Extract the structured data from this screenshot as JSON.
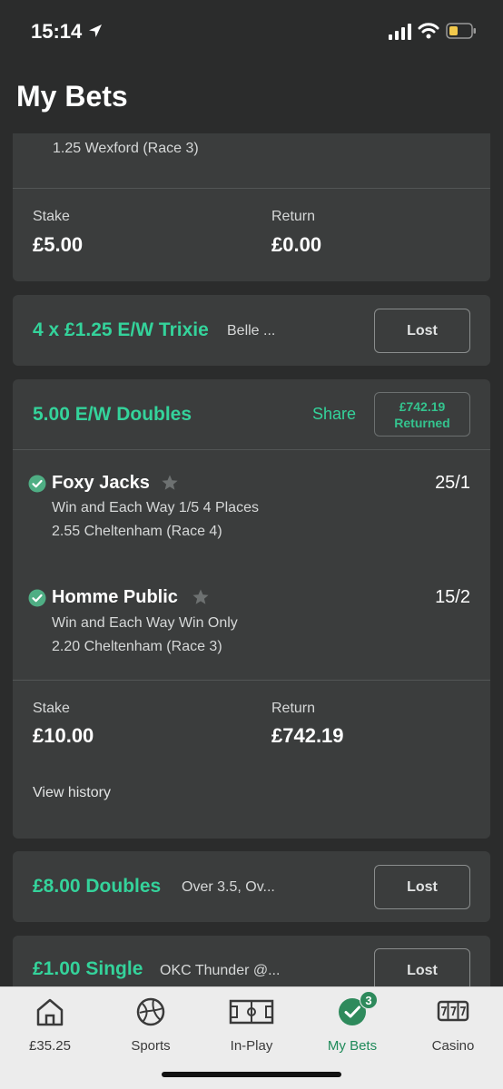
{
  "status_bar": {
    "time": "15:14"
  },
  "page": {
    "title": "My Bets"
  },
  "card1": {
    "partial_text": "1.25 Wexford (Race 3)",
    "stake_label": "Stake",
    "stake_value": "£5.00",
    "return_label": "Return",
    "return_value": "£0.00"
  },
  "card2": {
    "title": "4 x £1.25 E/W Trixie",
    "subtitle": "Belle ...",
    "status_button": "Lost"
  },
  "card3": {
    "title": "5.00 E/W Doubles",
    "share_label": "Share",
    "returned_amount": "£742.19",
    "returned_label": "Returned",
    "selections": [
      {
        "name": "Foxy Jacks",
        "odds": "25/1",
        "market": "Win and Each Way 1/5 4 Places",
        "event": "2.55 Cheltenham (Race 4)"
      },
      {
        "name": "Homme Public",
        "odds": "15/2",
        "market": "Win and Each Way Win Only",
        "event": "2.20 Cheltenham (Race 3)"
      }
    ],
    "stake_label": "Stake",
    "stake_value": "£10.00",
    "return_label": "Return",
    "return_value": "£742.19",
    "view_history": "View history"
  },
  "card4": {
    "title": "£8.00 Doubles",
    "subtitle": "Over 3.5, Ov...",
    "status_button": "Lost"
  },
  "card5": {
    "title": "£1.00 Single",
    "subtitle": "OKC Thunder @...",
    "status_button": "Lost"
  },
  "nav": {
    "items": [
      {
        "label": "£35.25",
        "icon": "home-icon"
      },
      {
        "label": "Sports",
        "icon": "football-icon"
      },
      {
        "label": "In-Play",
        "icon": "pitch-icon"
      },
      {
        "label": "My Bets",
        "icon": "check-icon",
        "badge": "3",
        "active": true
      },
      {
        "label": "Casino",
        "icon": "slots-icon"
      }
    ]
  },
  "colors": {
    "accent": "#34d39b",
    "background": "#2b2c2c",
    "card": "#3b3d3d",
    "nav_active": "#1f8a5a"
  }
}
